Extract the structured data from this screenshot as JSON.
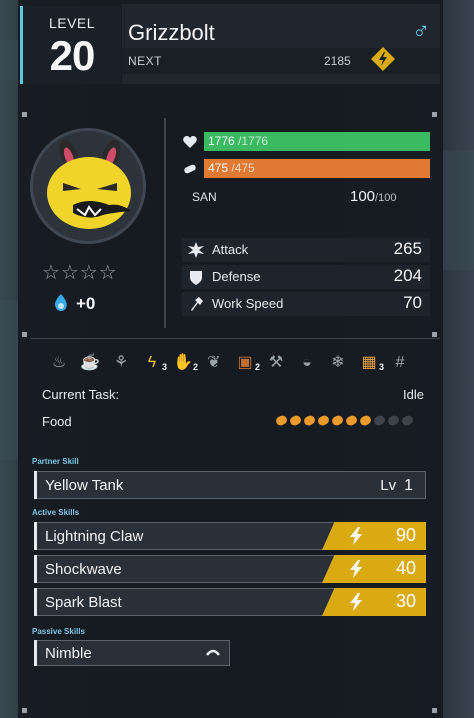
{
  "header": {
    "level_label": "LEVEL",
    "level": "20",
    "name": "Grizzbolt",
    "gender_icon": "male-icon",
    "next_label": "NEXT",
    "next_value": "2185",
    "element_icon": "electric-element-icon"
  },
  "status": {
    "hp": {
      "current": "1776",
      "max": "/1776",
      "fill": 1.0,
      "color": "#3cba62"
    },
    "sp": {
      "current": "475",
      "max": "/475",
      "fill": 1.0,
      "color": "#e07a32"
    },
    "san_label": "SAN",
    "san_value": "100",
    "san_max": "/100"
  },
  "rank": {
    "stars_filled": 0,
    "stars_total": 4,
    "souls": "+0"
  },
  "stats": [
    {
      "label": "Attack",
      "value": "265",
      "icon": "attack-icon"
    },
    {
      "label": "Defense",
      "value": "204",
      "icon": "defense-icon"
    },
    {
      "label": "Work Speed",
      "value": "70",
      "icon": "work-speed-icon"
    }
  ],
  "work_suitability": [
    {
      "icon": "kindling-icon",
      "level": ""
    },
    {
      "icon": "watering-icon",
      "level": ""
    },
    {
      "icon": "planting-icon",
      "level": ""
    },
    {
      "icon": "electricity-icon",
      "level": "3"
    },
    {
      "icon": "handiwork-icon",
      "level": "2"
    },
    {
      "icon": "gathering-icon",
      "level": ""
    },
    {
      "icon": "lumbering-icon",
      "level": "2"
    },
    {
      "icon": "mining-icon",
      "level": ""
    },
    {
      "icon": "medicine-icon",
      "level": ""
    },
    {
      "icon": "cooling-icon",
      "level": ""
    },
    {
      "icon": "transporting-icon",
      "level": "3"
    },
    {
      "icon": "farming-icon",
      "level": ""
    }
  ],
  "task": {
    "label": "Current Task:",
    "value": "Idle"
  },
  "food": {
    "label": "Food",
    "filled": 7,
    "total": 10
  },
  "partner": {
    "section_label": "Partner Skill",
    "name": "Yellow Tank",
    "lv_label": "Lv",
    "lv_value": "1"
  },
  "active": {
    "section_label": "Active Skills",
    "skills": [
      {
        "name": "Lightning Claw",
        "power": "90"
      },
      {
        "name": "Shockwave",
        "power": "40"
      },
      {
        "name": "Spark Blast",
        "power": "30"
      }
    ]
  },
  "passive": {
    "section_label": "Passive Skills",
    "skills": [
      {
        "name": "Nimble",
        "rank_icon": "rank-up-chevron-icon"
      }
    ]
  },
  "colors": {
    "accent": "#5ec8d8",
    "electric": "#d9aa12",
    "hp": "#3cba62",
    "sp": "#e07a32"
  }
}
